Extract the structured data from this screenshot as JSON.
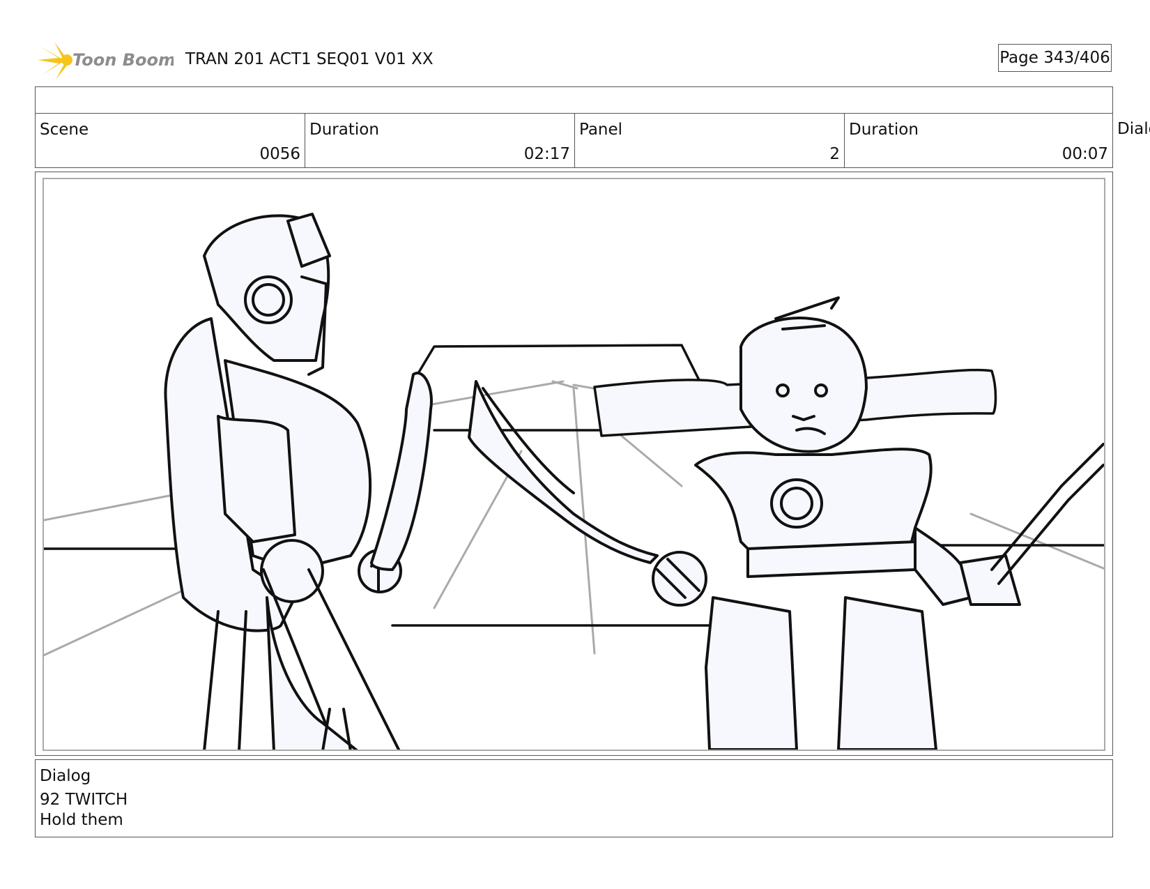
{
  "header": {
    "logo_text": "Toon Boom",
    "document_title": "TRAN 201 ACT1 SEQ01 V01 XX",
    "page": "Page 343/406"
  },
  "info": {
    "scene_label": "Scene",
    "scene_value": "0056",
    "scene_duration_label": "Duration",
    "scene_duration_value": "02:17",
    "panel_label": "Panel",
    "panel_value": "2",
    "panel_duration_label": "Duration",
    "panel_duration_value": "00:07",
    "overflow_label": "Dialo"
  },
  "dialog": {
    "label": "Dialog",
    "line1": "92 TWITCH",
    "line2": "Hold them"
  },
  "colors": {
    "logo_accent": "#f5c51c",
    "logo_text": "#8c8c8c",
    "sketch_ink": "#111111",
    "sketch_guides": "#aaaaaa",
    "character_fill": "#f6f8fd"
  }
}
